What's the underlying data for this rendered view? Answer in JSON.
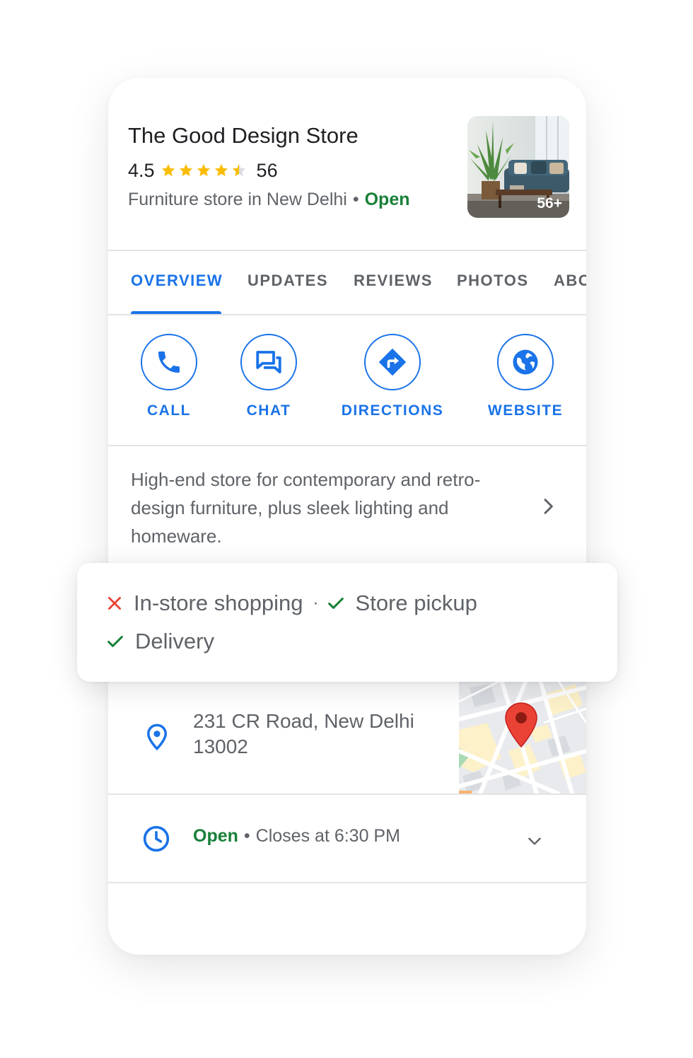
{
  "business": {
    "name": "The Good Design Store",
    "rating": "4.5",
    "rating_value": 4.5,
    "review_count": "56",
    "category": "Furniture store in New Delhi",
    "separator": "•",
    "status": "Open",
    "photo_count": "56+"
  },
  "tabs": [
    {
      "label": "OVERVIEW",
      "active": true
    },
    {
      "label": "UPDATES"
    },
    {
      "label": "REVIEWS"
    },
    {
      "label": "PHOTOS"
    },
    {
      "label": "ABOUT"
    }
  ],
  "actions": {
    "call": {
      "label": "CALL",
      "icon": "phone-icon"
    },
    "chat": {
      "label": "CHAT",
      "icon": "chat-icon"
    },
    "directions": {
      "label": "DIRECTIONS",
      "icon": "directions-icon"
    },
    "website": {
      "label": "WEBSITE",
      "icon": "globe-icon"
    }
  },
  "description": "High-end store for contemporary and retro-design furniture, plus sleek lighting and homeware.",
  "attributes": {
    "in_store": {
      "label": "In-store shopping",
      "available": false,
      "icon": "cross-icon"
    },
    "separator": "·",
    "pickup": {
      "label": "Store pickup",
      "available": true,
      "icon": "check-icon"
    },
    "delivery": {
      "label": "Delivery",
      "available": true,
      "icon": "check-icon"
    }
  },
  "address": {
    "line1": "231 CR Road, New Delhi",
    "line2": "13002"
  },
  "hours": {
    "status": "Open",
    "separator": "•",
    "closes": "Closes at 6:30 PM"
  },
  "colors": {
    "accent": "#1a73e8",
    "open_green": "#188038",
    "star_yellow": "#fbbc04",
    "cross_red": "#ea4335",
    "map_pin_red": "#ea4335"
  }
}
